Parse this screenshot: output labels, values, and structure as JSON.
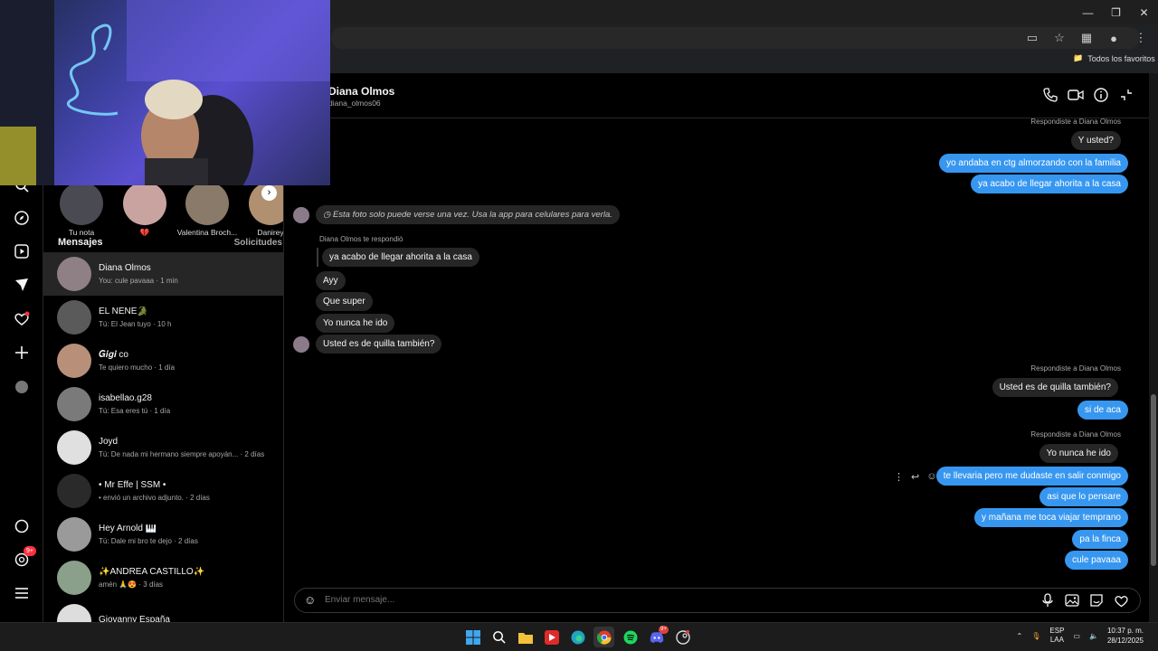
{
  "browser": {
    "bookmarks_label": "Todos los favoritos"
  },
  "nav_badge": "9+",
  "notes": [
    {
      "name": "Tu nota"
    },
    {
      "name": "💔"
    },
    {
      "name": "Valentina Broch..."
    },
    {
      "name": "Danirey"
    }
  ],
  "inbox": {
    "title": "Mensajes",
    "requests": "Solicitudes",
    "conversations": [
      {
        "name": "Diana Olmos",
        "preview": "You: cule pavaaa · 1 min"
      },
      {
        "name": "EL NENE🐊",
        "preview": "Tú: El Jean tuyo · 10 h"
      },
      {
        "name": "𝑮𝒊𝒈𝒊 co",
        "preview": "Te quiero mucho · 1 día"
      },
      {
        "name": "isabellao.g28",
        "preview": "Tú: Esa eres tú · 1 día"
      },
      {
        "name": "Joyd",
        "preview": "Tú: De nada mi hermano siempre apoyán... · 2 días"
      },
      {
        "name": "• Mr Effe | SSM •",
        "preview": "• envió un archivo adjunto. · 2 días"
      },
      {
        "name": "Hey Arnold 🎹",
        "preview": "Tú: Dale mi bro te dejo · 2 días"
      },
      {
        "name": "✨ANDREA CASTILLO✨",
        "preview": "amén 🙏😍 · 3 días"
      },
      {
        "name": "Giovanny España",
        "preview": ""
      }
    ]
  },
  "chat": {
    "name": "Diana Olmos",
    "username": "diana_olmos06",
    "meta_replied_1": "Respondiste a Diana Olmos",
    "quoted_1": "Y usted?",
    "out_1": "yo andaba en ctg almorzando con la familia",
    "out_2": "ya acabo de llegar ahorita a la casa",
    "photo_notice": "Esta foto solo puede verse una vez. Usa la app para celulares para verla.",
    "meta_they_replied": "Diana Olmos te respondió",
    "quoted_2": "ya acabo de llegar ahorita a la casa",
    "in_1": "Ayy",
    "in_2": "Que super",
    "in_3": "Yo nunca he ido",
    "in_4": "Usted es de quilla también?",
    "meta_replied_2": "Respondiste a Diana Olmos",
    "quoted_3": "Usted es de quilla también?",
    "out_3": "si de aca",
    "meta_replied_3": "Respondiste a Diana Olmos",
    "quoted_4": "Yo nunca he ido",
    "out_4": "te llevaria pero me dudaste en salir conmigo",
    "out_5": "asi que lo pensare",
    "out_6": "y mañana me toca viajar temprano",
    "out_7": "pa la finca",
    "out_8": "cule pavaaa",
    "composer_placeholder": "Enviar mensaje..."
  },
  "taskbar": {
    "lang_1": "ESP",
    "lang_2": "LAA",
    "time": "10:37 p. m.",
    "date": "28/12/2025",
    "discord_badge": "9+"
  }
}
